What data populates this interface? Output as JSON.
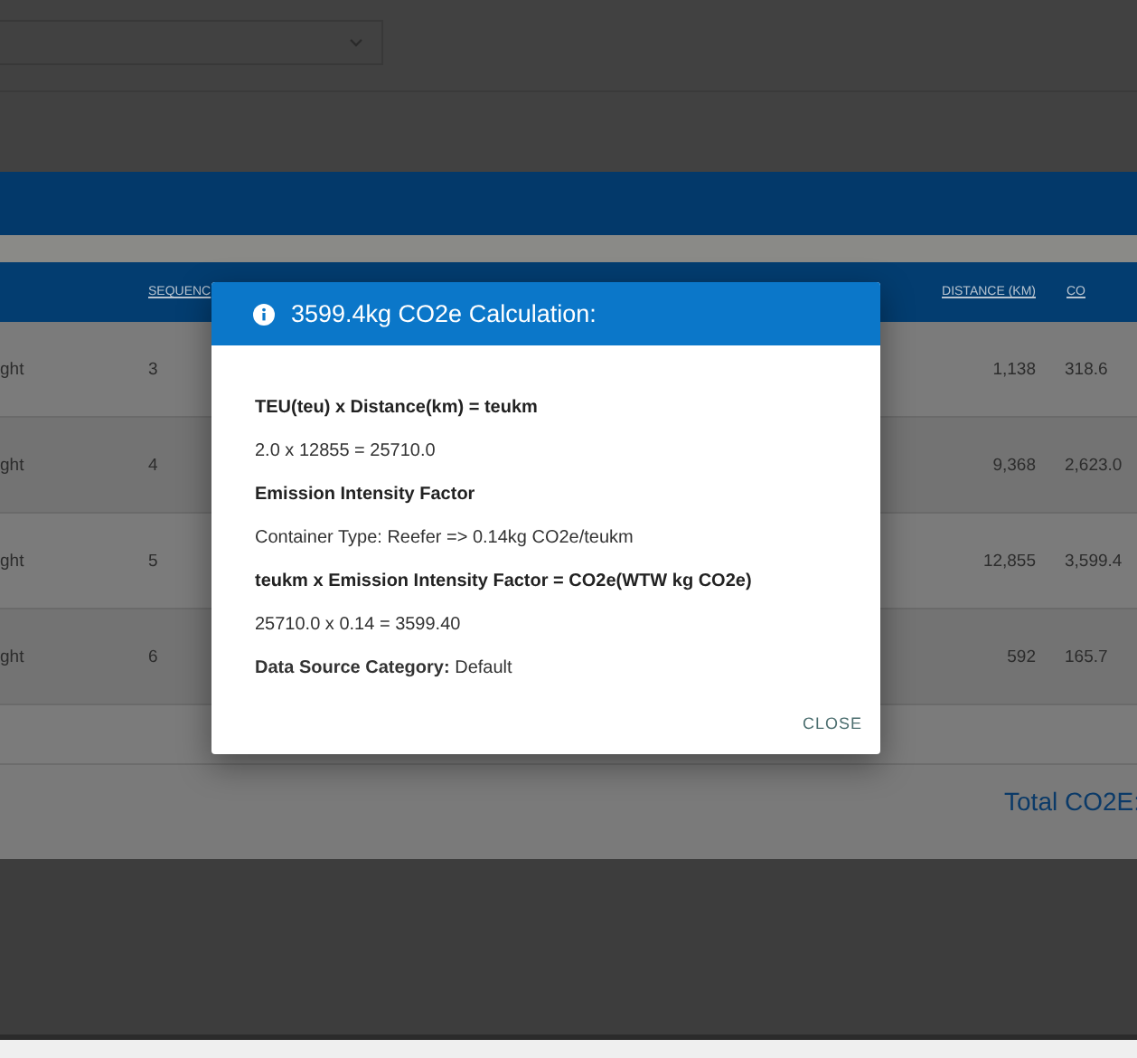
{
  "table": {
    "columns": [
      "",
      "SEQUENC",
      "DISTANCE (KM)",
      "CO"
    ],
    "rows": [
      {
        "cells": [
          "ght",
          "3",
          "1,138",
          "318.6"
        ]
      },
      {
        "cells": [
          "ght",
          "4",
          "9,368",
          "2,623.0"
        ]
      },
      {
        "cells": [
          "ght",
          "5",
          "12,855",
          "3,599.4"
        ]
      },
      {
        "cells": [
          "ght",
          "6",
          "592",
          "165.7"
        ]
      }
    ],
    "total_label": "Total CO2E:"
  },
  "dialog": {
    "title": "3599.4kg CO2e Calculation:",
    "lines": [
      {
        "kind": "heading",
        "text": "TEU(teu) x Distance(km) = teukm"
      },
      {
        "kind": "value",
        "text": "2.0 x 12855 = 25710.0"
      },
      {
        "kind": "heading",
        "text": "Emission Intensity Factor"
      },
      {
        "kind": "value",
        "text": "Container Type: Reefer => 0.14kg CO2e/teukm"
      },
      {
        "kind": "heading",
        "text": "teukm x Emission Intensity Factor = CO2e(WTW kg CO2e)"
      },
      {
        "kind": "value",
        "text": "25710.0 x 0.14 = 3599.40"
      },
      {
        "kind": "field",
        "label": "Data Source Category:",
        "value": "Default"
      }
    ],
    "close_label": "CLOSE"
  }
}
